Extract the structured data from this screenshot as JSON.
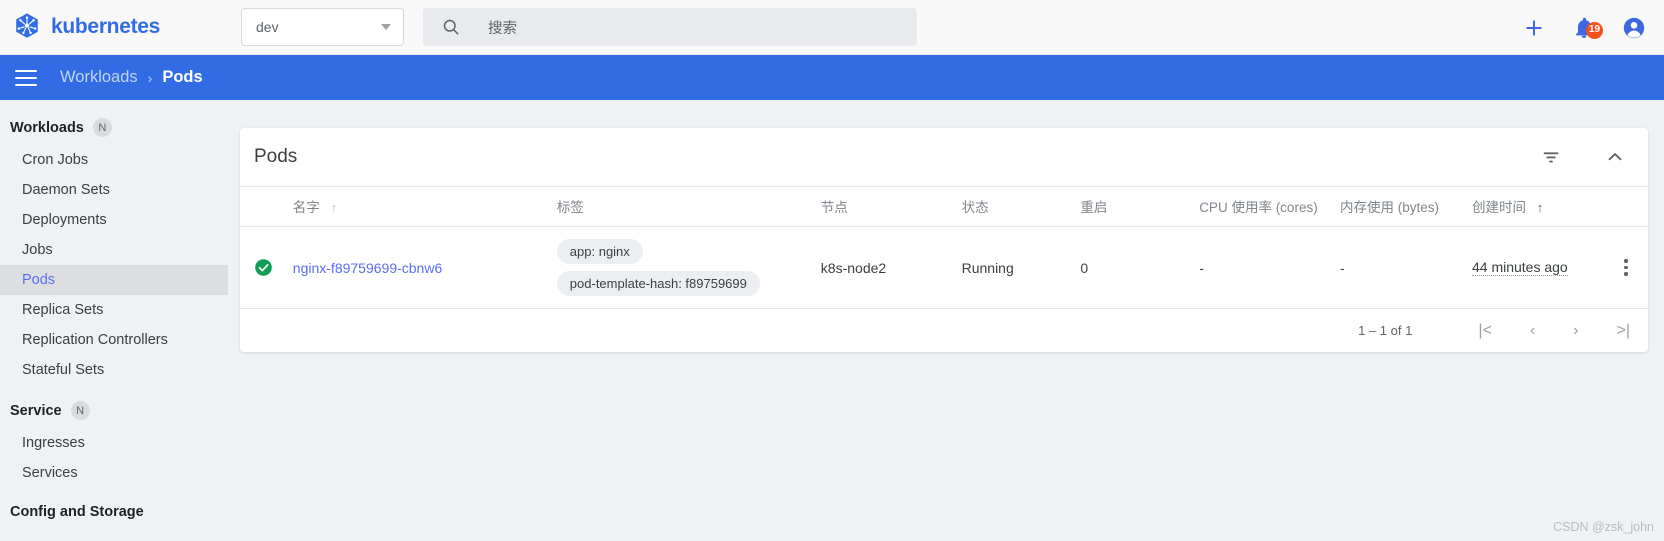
{
  "topbar": {
    "brand": "kubernetes",
    "brand_icon": "kubernetes-helm-logo-icon",
    "namespace_value": "dev",
    "namespace_caret_icon": "chevron-down-icon",
    "search_icon": "search-icon",
    "search_placeholder": "搜索",
    "search_value": "",
    "add_icon": "plus-icon",
    "notifications_icon": "bell-icon",
    "notifications_count": "19",
    "account_icon": "account-circle-icon"
  },
  "breadcrumb": {
    "menu_icon": "hamburger-menu-icon",
    "parent": "Workloads",
    "separator": "›",
    "current": "Pods"
  },
  "sidebar": {
    "sections": [
      {
        "title": "Workloads",
        "badge": "N",
        "items": [
          {
            "label": "Cron Jobs",
            "active": false
          },
          {
            "label": "Daemon Sets",
            "active": false
          },
          {
            "label": "Deployments",
            "active": false
          },
          {
            "label": "Jobs",
            "active": false
          },
          {
            "label": "Pods",
            "active": true
          },
          {
            "label": "Replica Sets",
            "active": false
          },
          {
            "label": "Replication Controllers",
            "active": false
          },
          {
            "label": "Stateful Sets",
            "active": false
          }
        ]
      },
      {
        "title": "Service",
        "badge": "N",
        "items": [
          {
            "label": "Ingresses",
            "active": false
          },
          {
            "label": "Services",
            "active": false
          }
        ]
      },
      {
        "title": "Config and Storage",
        "badge": "",
        "items": []
      }
    ]
  },
  "card": {
    "title": "Pods",
    "filter_icon": "filter-list-icon",
    "collapse_icon": "chevron-up-icon"
  },
  "table": {
    "columns": [
      {
        "label": "名字",
        "sort": "up",
        "sort_active": false
      },
      {
        "label": "标签",
        "sort": "",
        "sort_active": false
      },
      {
        "label": "节点",
        "sort": "",
        "sort_active": false
      },
      {
        "label": "状态",
        "sort": "",
        "sort_active": false
      },
      {
        "label": "重启",
        "sort": "",
        "sort_active": false
      },
      {
        "label": "CPU 使用率 (cores)",
        "sort": "",
        "sort_active": false
      },
      {
        "label": "内存使用 (bytes)",
        "sort": "",
        "sort_active": false
      },
      {
        "label": "创建时间",
        "sort": "up",
        "sort_active": true
      }
    ],
    "rows": [
      {
        "status_icon": "check-circle-icon",
        "status_color": "#0f9d58",
        "name": "nginx-f89759699-cbnw6",
        "labels": [
          "app: nginx",
          "pod-template-hash: f89759699"
        ],
        "node": "k8s-node2",
        "state": "Running",
        "restarts": "0",
        "cpu": "-",
        "memory": "-",
        "age": "44 minutes ago",
        "menu_icon": "more-vert-icon"
      }
    ]
  },
  "pagination": {
    "range_label": "1 – 1 of 1",
    "first_icon": "|<",
    "prev_icon": "‹",
    "next_icon": "›",
    "last_icon": ">|"
  },
  "watermark": "CSDN @zsk_john"
}
